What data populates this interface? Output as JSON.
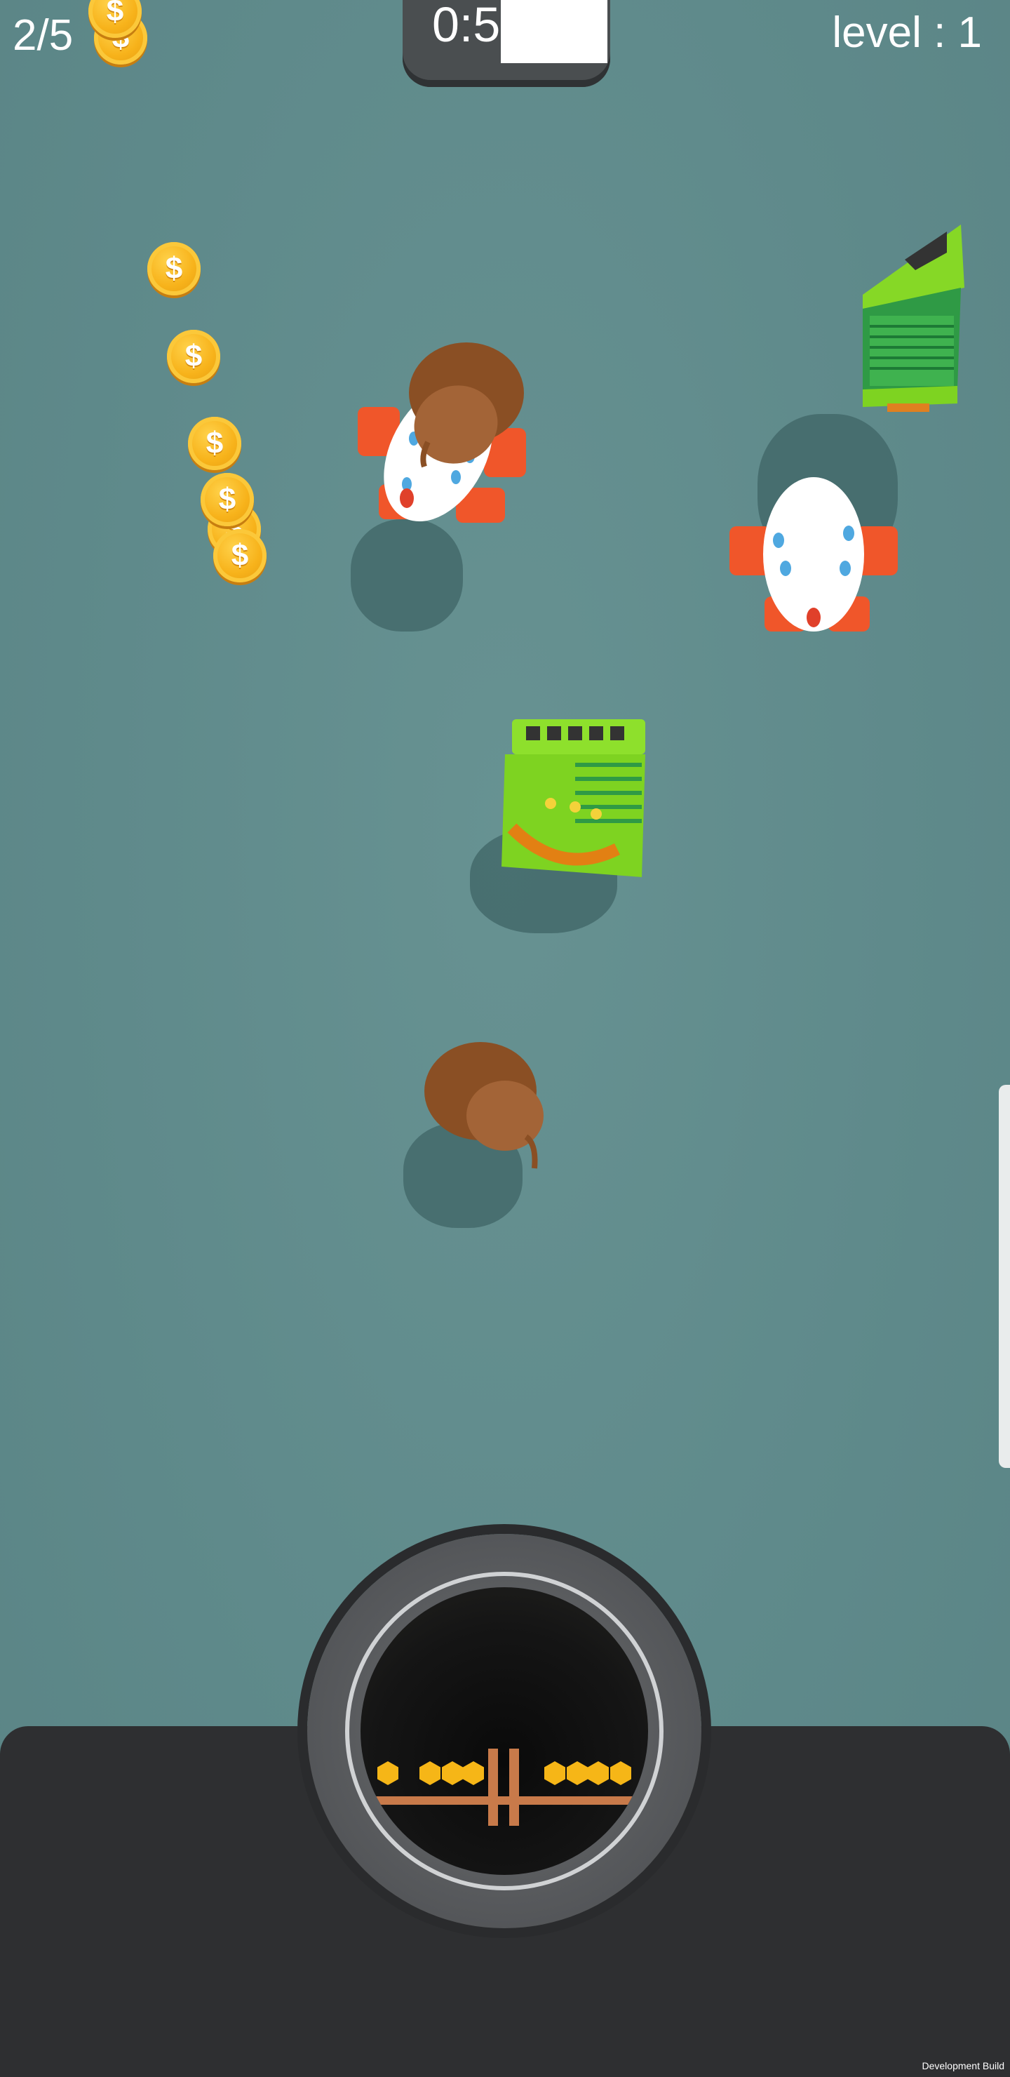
{
  "hud": {
    "score": "2/5",
    "timer": "0:5",
    "level": "level : 1"
  },
  "coins": {
    "symbol": "$"
  },
  "footer": {
    "build_label": "Development Build"
  },
  "colors": {
    "background": "#5f8a8b",
    "coin": "#f7b21a",
    "hole_bar": "#2e2f31",
    "accordion_green": "#7ed321",
    "rocket_fin": "#f0562a",
    "acorn": "#8a4f24"
  },
  "icons": [
    "coin-icon",
    "accordion-toy",
    "rocket-toy",
    "acorn-toy",
    "hole"
  ]
}
